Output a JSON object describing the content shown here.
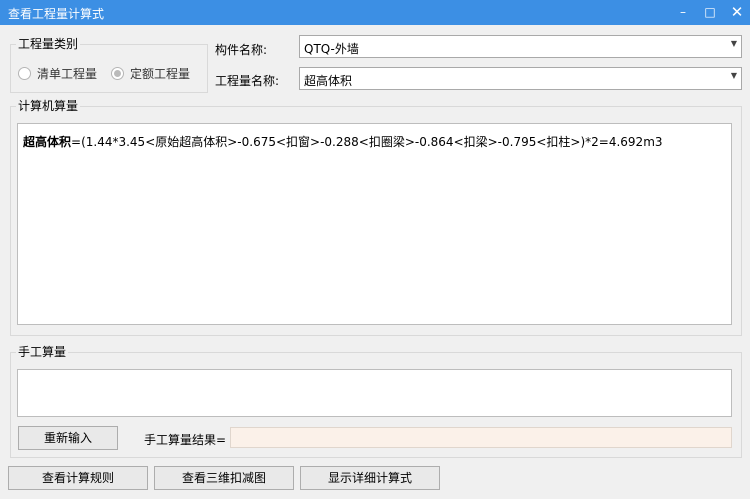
{
  "window": {
    "title": "查看工程量计算式",
    "min_label": "–",
    "max_label": "□",
    "close_label": "✕"
  },
  "category": {
    "label": "工程量类别",
    "options": [
      {
        "label": "清单工程量",
        "checked": false
      },
      {
        "label": "定额工程量",
        "checked": true
      }
    ]
  },
  "component": {
    "label": "构件名称:",
    "value": "QTQ-外墙"
  },
  "quantity": {
    "label": "工程量名称:",
    "value": "超高体积"
  },
  "computer_calc": {
    "label": "计算机算量",
    "formula_name": "超高体积",
    "formula_body": "=(1.44*3.45<原始超高体积>-0.675<扣窗>-0.288<扣圈梁>-0.864<扣梁>-0.795<扣柱>)*2=4.692m3"
  },
  "manual_calc": {
    "label": "手工算量",
    "input_value": "",
    "reinput_label": "重新输入",
    "result_label": "手工算量结果=",
    "result_value": ""
  },
  "footer": {
    "rules_label": "查看计算规则",
    "view3d_label": "查看三维扣减图",
    "detail_label": "显示详细计算式"
  }
}
